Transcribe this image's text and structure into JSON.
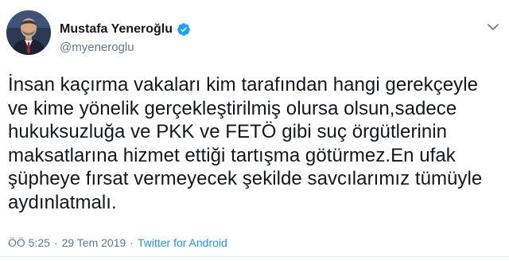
{
  "user": {
    "display_name": "Mustafa Yeneroğlu",
    "handle": "@myeneroglu",
    "verified": true
  },
  "tweet": {
    "text": "İnsan kaçırma vakaları kim tarafından hangi gerekçeyle\nve kime yönelik gerçekleştirilmiş olursa olsun,sadece\nhukuksuzluğa ve PKK ve FETÖ gibi suç örgütlerinin\nmaksatlarına hizmet ettiği tartışma götürmez.En ufak\nşüpheye fırsat vermeyecek şekilde savcılarımız tümüyle\naydınlatmalı.",
    "time": "ÖÖ 5:25",
    "separator": "·",
    "date": "29 Tem 2019",
    "source": "Twitter for Android"
  },
  "icons": {
    "verified": "verified-badge-icon",
    "menu": "chevron-down-icon"
  },
  "colors": {
    "primary_text": "#14171a",
    "secondary_text": "#657786",
    "link": "#1b95e0",
    "verified_badge": "#1da1f2"
  }
}
